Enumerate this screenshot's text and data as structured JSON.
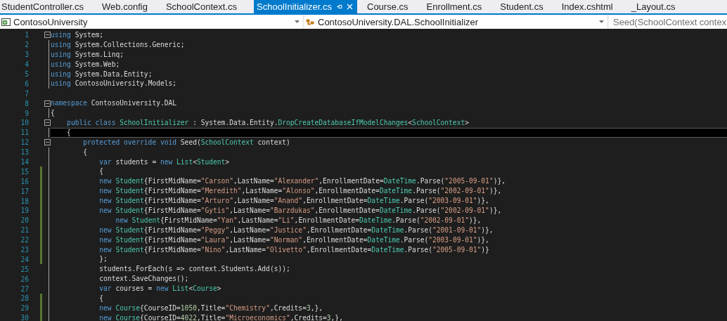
{
  "tabs": [
    {
      "label": "StudentController.cs",
      "selected": false
    },
    {
      "label": "Web.config",
      "selected": false
    },
    {
      "label": "SchoolContext.cs",
      "selected": false
    },
    {
      "label": "SchoolInitializer.cs",
      "selected": true
    },
    {
      "label": "Course.cs",
      "selected": false
    },
    {
      "label": "Enrollment.cs",
      "selected": false
    },
    {
      "label": "Student.cs",
      "selected": false
    },
    {
      "label": "Index.cshtml",
      "selected": false
    },
    {
      "label": "_Layout.cs",
      "selected": false
    }
  ],
  "navigation_bar": {
    "project": "ContosoUniversity",
    "type": "ContosoUniversity.DAL.SchoolInitializer",
    "member": "Seed(SchoolContext contex"
  },
  "lines": [
    {
      "number": "1",
      "fold": true,
      "changed": false,
      "current": false,
      "tokens": [
        {
          "kind": "keyword",
          "text": "using"
        },
        {
          "kind": "plain",
          "text": " System;"
        }
      ]
    },
    {
      "number": "2",
      "fold": false,
      "changed": false,
      "current": false,
      "tokens": [
        {
          "kind": "keyword",
          "text": "using"
        },
        {
          "kind": "plain",
          "text": " System.Collections.Generic;"
        }
      ]
    },
    {
      "number": "3",
      "fold": false,
      "changed": false,
      "current": false,
      "tokens": [
        {
          "kind": "keyword",
          "text": "using"
        },
        {
          "kind": "plain",
          "text": " System.Linq;"
        }
      ]
    },
    {
      "number": "4",
      "fold": false,
      "changed": false,
      "current": false,
      "tokens": [
        {
          "kind": "keyword",
          "text": "using"
        },
        {
          "kind": "plain",
          "text": " System.Web;"
        }
      ]
    },
    {
      "number": "5",
      "fold": false,
      "changed": false,
      "current": false,
      "tokens": [
        {
          "kind": "keyword",
          "text": "using"
        },
        {
          "kind": "plain",
          "text": " System.Data.Entity;"
        }
      ]
    },
    {
      "number": "6",
      "fold": false,
      "changed": false,
      "current": false,
      "tokens": [
        {
          "kind": "keyword",
          "text": "using"
        },
        {
          "kind": "plain",
          "text": " ContosoUniversity.Models;"
        }
      ]
    },
    {
      "number": "7",
      "fold": false,
      "changed": false,
      "current": false
    },
    {
      "number": "8",
      "fold": true,
      "changed": false,
      "current": false,
      "tokens": [
        {
          "kind": "keyword",
          "text": "namespace"
        },
        {
          "kind": "plain",
          "text": " ContosoUniversity.DAL"
        }
      ]
    },
    {
      "number": "9",
      "fold": false,
      "changed": false,
      "current": false,
      "tokens": [
        {
          "kind": "plain",
          "text": "{"
        }
      ]
    },
    {
      "number": "10",
      "fold": true,
      "changed": false,
      "current": false,
      "tokens": [
        {
          "kind": "keyword",
          "text": "    public class "
        },
        {
          "kind": "type",
          "text": "SchoolInitializer"
        },
        {
          "kind": "plain",
          "text": " : System.Data.Entity."
        },
        {
          "kind": "type",
          "text": "DropCreateDatabaseIfModelChanges"
        },
        {
          "kind": "plain",
          "text": "<"
        },
        {
          "kind": "type",
          "text": "SchoolContext"
        },
        {
          "kind": "plain",
          "text": ">"
        }
      ]
    },
    {
      "number": "11",
      "fold": false,
      "changed": false,
      "current": true,
      "tokens": [
        {
          "kind": "plain",
          "text": "    {"
        }
      ]
    },
    {
      "number": "12",
      "fold": true,
      "changed": false,
      "current": false,
      "tokens": [
        {
          "kind": "keyword",
          "text": "        protected override void"
        },
        {
          "kind": "plain",
          "text": " Seed("
        },
        {
          "kind": "type",
          "text": "SchoolContext"
        },
        {
          "kind": "plain",
          "text": " context)"
        }
      ]
    },
    {
      "number": "13",
      "fold": false,
      "changed": false,
      "current": false,
      "tokens": [
        {
          "kind": "plain",
          "text": "        {"
        }
      ]
    },
    {
      "number": "14",
      "fold": false,
      "changed": false,
      "current": false,
      "tokens": [
        {
          "kind": "keyword",
          "text": "            var"
        },
        {
          "kind": "plain",
          "text": " students = "
        },
        {
          "kind": "keyword",
          "text": "new "
        },
        {
          "kind": "type",
          "text": "List"
        },
        {
          "kind": "plain",
          "text": "<"
        },
        {
          "kind": "type",
          "text": "Student"
        },
        {
          "kind": "plain",
          "text": ">"
        }
      ]
    },
    {
      "number": "15",
      "fold": false,
      "changed": true,
      "current": false,
      "tokens": [
        {
          "kind": "plain",
          "text": "            {"
        }
      ]
    },
    {
      "number": "16",
      "fold": false,
      "changed": true,
      "current": false,
      "tokens": [
        {
          "kind": "keyword",
          "text": "            new "
        },
        {
          "kind": "type",
          "text": "Student"
        },
        {
          "kind": "plain",
          "text": "{FirstMidName="
        },
        {
          "kind": "string",
          "text": "\"Carson\""
        },
        {
          "kind": "plain",
          "text": ",LastName="
        },
        {
          "kind": "string",
          "text": "\"Alexander\""
        },
        {
          "kind": "plain",
          "text": ",EnrollmentDate="
        },
        {
          "kind": "type",
          "text": "DateTime"
        },
        {
          "kind": "plain",
          "text": ".Parse("
        },
        {
          "kind": "string",
          "text": "\"2005-09-01\""
        },
        {
          "kind": "plain",
          "text": ")},"
        }
      ]
    },
    {
      "number": "17",
      "fold": false,
      "changed": true,
      "current": false,
      "tokens": [
        {
          "kind": "keyword",
          "text": "            new "
        },
        {
          "kind": "type",
          "text": "Student"
        },
        {
          "kind": "plain",
          "text": "{FirstMidName="
        },
        {
          "kind": "string",
          "text": "\"Meredith\""
        },
        {
          "kind": "plain",
          "text": ",LastName="
        },
        {
          "kind": "string",
          "text": "\"Alonso\""
        },
        {
          "kind": "plain",
          "text": ",EnrollmentDate="
        },
        {
          "kind": "type",
          "text": "DateTime"
        },
        {
          "kind": "plain",
          "text": ".Parse("
        },
        {
          "kind": "string",
          "text": "\"2002-09-01\""
        },
        {
          "kind": "plain",
          "text": ")},"
        }
      ]
    },
    {
      "number": "18",
      "fold": false,
      "changed": true,
      "current": false,
      "tokens": [
        {
          "kind": "keyword",
          "text": "            new "
        },
        {
          "kind": "type",
          "text": "Student"
        },
        {
          "kind": "plain",
          "text": "{FirstMidName="
        },
        {
          "kind": "string",
          "text": "\"Arturo\""
        },
        {
          "kind": "plain",
          "text": ",LastName="
        },
        {
          "kind": "string",
          "text": "\"Anand\""
        },
        {
          "kind": "plain",
          "text": ",EnrollmentDate="
        },
        {
          "kind": "type",
          "text": "DateTime"
        },
        {
          "kind": "plain",
          "text": ".Parse("
        },
        {
          "kind": "string",
          "text": "\"2003-09-01\""
        },
        {
          "kind": "plain",
          "text": ")},"
        }
      ]
    },
    {
      "number": "19",
      "fold": false,
      "changed": true,
      "current": false,
      "tokens": [
        {
          "kind": "keyword",
          "text": "            new "
        },
        {
          "kind": "type",
          "text": "Student"
        },
        {
          "kind": "plain",
          "text": "{FirstMidName="
        },
        {
          "kind": "string",
          "text": "\"Gytis\""
        },
        {
          "kind": "plain",
          "text": ",LastName="
        },
        {
          "kind": "string",
          "text": "\"Barzdukas\""
        },
        {
          "kind": "plain",
          "text": ",EnrollmentDate="
        },
        {
          "kind": "type",
          "text": "DateTime"
        },
        {
          "kind": "plain",
          "text": ".Parse("
        },
        {
          "kind": "string",
          "text": "\"2002-09-01\""
        },
        {
          "kind": "plain",
          "text": ")},"
        }
      ]
    },
    {
      "number": "20",
      "fold": false,
      "changed": true,
      "current": false,
      "tokens": [
        {
          "kind": "keyword",
          "text": "                new "
        },
        {
          "kind": "type",
          "text": "Student"
        },
        {
          "kind": "plain",
          "text": "{FirstMidName="
        },
        {
          "kind": "string",
          "text": "\"Yan\""
        },
        {
          "kind": "plain",
          "text": ",LastName="
        },
        {
          "kind": "string",
          "text": "\"Li\""
        },
        {
          "kind": "plain",
          "text": ",EnrollmentDate="
        },
        {
          "kind": "type",
          "text": "DateTime"
        },
        {
          "kind": "plain",
          "text": ".Parse("
        },
        {
          "kind": "string",
          "text": "\"2002-09-01\""
        },
        {
          "kind": "plain",
          "text": ")},"
        }
      ]
    },
    {
      "number": "21",
      "fold": false,
      "changed": true,
      "current": false,
      "tokens": [
        {
          "kind": "keyword",
          "text": "            new "
        },
        {
          "kind": "type",
          "text": "Student"
        },
        {
          "kind": "plain",
          "text": "{FirstMidName="
        },
        {
          "kind": "string",
          "text": "\"Peggy\""
        },
        {
          "kind": "plain",
          "text": ",LastName="
        },
        {
          "kind": "string",
          "text": "\"Justice\""
        },
        {
          "kind": "plain",
          "text": ",EnrollmentDate="
        },
        {
          "kind": "type",
          "text": "DateTime"
        },
        {
          "kind": "plain",
          "text": ".Parse("
        },
        {
          "kind": "string",
          "text": "\"2001-09-01\""
        },
        {
          "kind": "plain",
          "text": ")},"
        }
      ]
    },
    {
      "number": "22",
      "fold": false,
      "changed": true,
      "current": false,
      "tokens": [
        {
          "kind": "keyword",
          "text": "            new "
        },
        {
          "kind": "type",
          "text": "Student"
        },
        {
          "kind": "plain",
          "text": "{FirstMidName="
        },
        {
          "kind": "string",
          "text": "\"Laura\""
        },
        {
          "kind": "plain",
          "text": ",LastName="
        },
        {
          "kind": "string",
          "text": "\"Norman\""
        },
        {
          "kind": "plain",
          "text": ",EnrollmentDate="
        },
        {
          "kind": "type",
          "text": "DateTime"
        },
        {
          "kind": "plain",
          "text": ".Parse("
        },
        {
          "kind": "string",
          "text": "\"2003-09-01\""
        },
        {
          "kind": "plain",
          "text": ")},"
        }
      ]
    },
    {
      "number": "23",
      "fold": false,
      "changed": true,
      "current": false,
      "tokens": [
        {
          "kind": "keyword",
          "text": "            new "
        },
        {
          "kind": "type",
          "text": "Student"
        },
        {
          "kind": "plain",
          "text": "{FirstMidName="
        },
        {
          "kind": "string",
          "text": "\"Nino\""
        },
        {
          "kind": "plain",
          "text": ",LastName="
        },
        {
          "kind": "string",
          "text": "\"Olivetto\""
        },
        {
          "kind": "plain",
          "text": ",EnrollmentDate="
        },
        {
          "kind": "type",
          "text": "DateTime"
        },
        {
          "kind": "plain",
          "text": ".Parse("
        },
        {
          "kind": "string",
          "text": "\"2005-09-01\""
        },
        {
          "kind": "plain",
          "text": ")}"
        }
      ]
    },
    {
      "number": "24",
      "fold": false,
      "changed": true,
      "current": false,
      "tokens": [
        {
          "kind": "plain",
          "text": "            };"
        }
      ]
    },
    {
      "number": "25",
      "fold": false,
      "changed": false,
      "current": false,
      "tokens": [
        {
          "kind": "plain",
          "text": "            students.ForEach(s => context.Students.Add(s));"
        }
      ]
    },
    {
      "number": "26",
      "fold": false,
      "changed": false,
      "current": false,
      "tokens": [
        {
          "kind": "plain",
          "text": "            context.SaveChanges();"
        }
      ]
    },
    {
      "number": "27",
      "fold": false,
      "changed": false,
      "current": false,
      "tokens": [
        {
          "kind": "keyword",
          "text": "            var"
        },
        {
          "kind": "plain",
          "text": " courses = "
        },
        {
          "kind": "keyword",
          "text": "new "
        },
        {
          "kind": "type",
          "text": "List"
        },
        {
          "kind": "plain",
          "text": "<"
        },
        {
          "kind": "type",
          "text": "Course"
        },
        {
          "kind": "plain",
          "text": ">"
        }
      ]
    },
    {
      "number": "28",
      "fold": false,
      "changed": true,
      "current": false,
      "tokens": [
        {
          "kind": "plain",
          "text": "            {"
        }
      ]
    },
    {
      "number": "29",
      "fold": false,
      "changed": true,
      "current": false,
      "tokens": [
        {
          "kind": "keyword",
          "text": "            new "
        },
        {
          "kind": "type",
          "text": "Course"
        },
        {
          "kind": "plain",
          "text": "{CourseID="
        },
        {
          "kind": "number",
          "text": "1050"
        },
        {
          "kind": "plain",
          "text": ",Title="
        },
        {
          "kind": "string",
          "text": "\"Chemistry\""
        },
        {
          "kind": "plain",
          "text": ",Credits="
        },
        {
          "kind": "number",
          "text": "3"
        },
        {
          "kind": "plain",
          "text": ",},"
        }
      ]
    },
    {
      "number": "30",
      "fold": false,
      "changed": true,
      "current": false,
      "tokens": [
        {
          "kind": "keyword",
          "text": "            new "
        },
        {
          "kind": "type",
          "text": "Course"
        },
        {
          "kind": "plain",
          "text": "{CourseID="
        },
        {
          "kind": "number",
          "text": "4022"
        },
        {
          "kind": "plain",
          "text": ",Title="
        },
        {
          "kind": "string",
          "text": "\"Microeconomics\""
        },
        {
          "kind": "plain",
          "text": ",Credits="
        },
        {
          "kind": "number",
          "text": "3"
        },
        {
          "kind": "plain",
          "text": ",},"
        }
      ]
    }
  ]
}
